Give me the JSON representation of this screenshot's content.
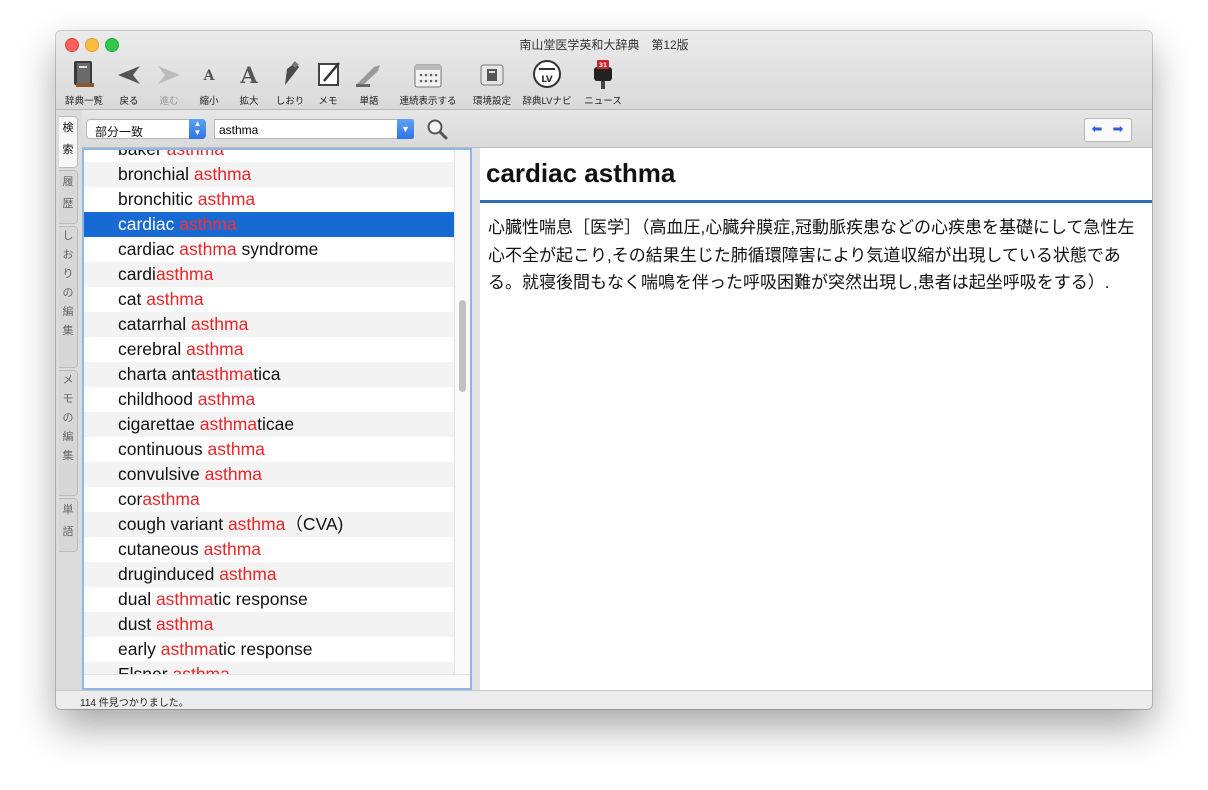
{
  "window": {
    "title": "南山堂医学英和大辞典　第12版"
  },
  "toolbar": {
    "items": [
      {
        "label": "辞典一覧",
        "icon": "dictionary-books-icon"
      },
      {
        "label": "戻る",
        "icon": "back-arrow-icon"
      },
      {
        "label": "進む",
        "icon": "forward-arrow-icon",
        "disabled": true
      },
      {
        "label": "縮小",
        "icon": "shrink-font-icon"
      },
      {
        "label": "拡大",
        "icon": "enlarge-font-icon"
      },
      {
        "label": "しおり",
        "icon": "bookmark-icon"
      },
      {
        "label": "メモ",
        "icon": "memo-icon"
      },
      {
        "label": "単語",
        "icon": "word-icon"
      },
      {
        "label": "連続表示する",
        "icon": "continuous-view-icon"
      },
      {
        "label": "環境設定",
        "icon": "preferences-icon"
      },
      {
        "label": "辞典LVナビ",
        "icon": "lv-navi-icon"
      },
      {
        "label": "ニュース",
        "icon": "news-mailbox-icon",
        "badge": "31"
      }
    ]
  },
  "search": {
    "mode": "部分一致",
    "query": "asthma",
    "nav_back": "⬅",
    "nav_forward": "➡"
  },
  "sidetabs": [
    {
      "chars": [
        "検",
        "索"
      ],
      "active": true
    },
    {
      "chars": [
        "履",
        "歴"
      ],
      "active": false
    },
    {
      "chars": [
        "し",
        "お",
        "り",
        "の",
        "編",
        "集"
      ],
      "active": false
    },
    {
      "chars": [
        "メ",
        "モ",
        "の",
        "編",
        "集"
      ],
      "active": false
    },
    {
      "chars": [
        "単",
        "語"
      ],
      "active": false
    }
  ],
  "results": [
    {
      "pre": "baker ",
      "hit": "asthma",
      "post": ""
    },
    {
      "pre": "bronchial ",
      "hit": "asthma",
      "post": ""
    },
    {
      "pre": "bronchitic ",
      "hit": "asthma",
      "post": ""
    },
    {
      "pre": "cardiac ",
      "hit": "asthma",
      "post": "",
      "selected": true
    },
    {
      "pre": "cardiac ",
      "hit": "asthma",
      "post": " syndrome"
    },
    {
      "pre": "cardi",
      "hit": "asthma",
      "post": ""
    },
    {
      "pre": "cat ",
      "hit": "asthma",
      "post": ""
    },
    {
      "pre": "catarrhal ",
      "hit": "asthma",
      "post": ""
    },
    {
      "pre": "cerebral ",
      "hit": "asthma",
      "post": ""
    },
    {
      "pre": "charta ant",
      "hit": "asthma",
      "post": "tica"
    },
    {
      "pre": "childhood ",
      "hit": "asthma",
      "post": ""
    },
    {
      "pre": "cigarettae ",
      "hit": "asthma",
      "post": "ticae"
    },
    {
      "pre": "continuous ",
      "hit": "asthma",
      "post": ""
    },
    {
      "pre": "convulsive ",
      "hit": "asthma",
      "post": ""
    },
    {
      "pre": "cor",
      "hit": "asthma",
      "post": ""
    },
    {
      "pre": "cough variant ",
      "hit": "asthma",
      "post": "（CVA)"
    },
    {
      "pre": "cutaneous ",
      "hit": "asthma",
      "post": ""
    },
    {
      "pre": "druginduced ",
      "hit": "asthma",
      "post": ""
    },
    {
      "pre": "dual ",
      "hit": "asthma",
      "post": "tic response"
    },
    {
      "pre": "dust ",
      "hit": "asthma",
      "post": ""
    },
    {
      "pre": "early ",
      "hit": "asthma",
      "post": "tic response"
    },
    {
      "pre": "Elsner ",
      "hit": "asthma",
      "post": ""
    }
  ],
  "entry": {
    "headword": "cardiac asthma",
    "definition": "心臓性喘息［医学］（高血圧,心臓弁膜症,冠動脈疾患などの心疾患を基礎にして急性左心不全が起こり,その結果生じた肺循環障害により気道収縮が出現している状態である。就寝後間もなく喘鳴を伴った呼吸困難が突然出現し,患者は起坐呼吸をする）."
  },
  "status": {
    "text": "114 件見つかりました。"
  },
  "colors": {
    "highlight": "#e6262b",
    "selection": "#1769d3",
    "rule": "#2d6db0"
  }
}
